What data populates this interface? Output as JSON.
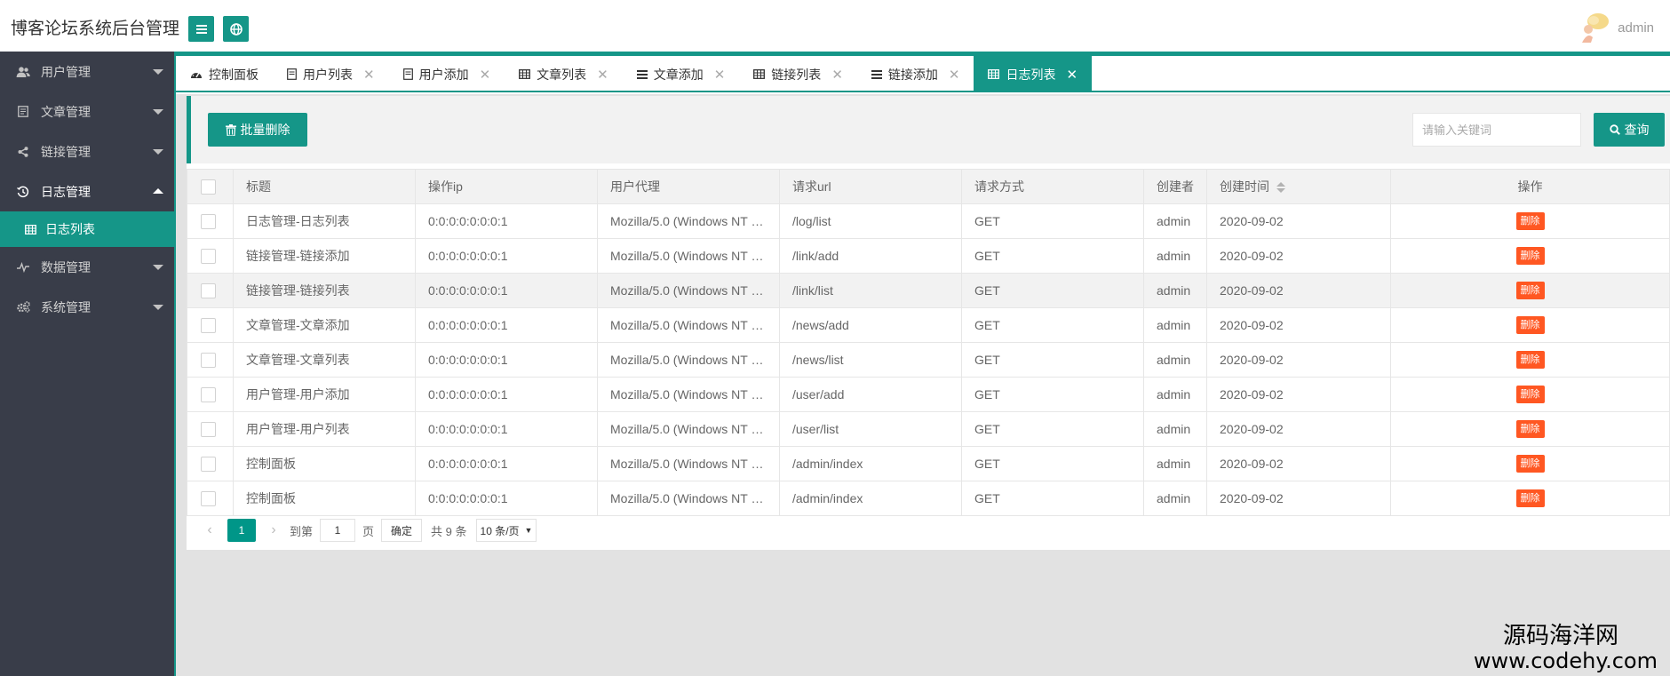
{
  "app": {
    "title": "博客论坛系统后台管理"
  },
  "header": {
    "username": "admin"
  },
  "sidebar": {
    "items": [
      {
        "label": "用户管理",
        "icon": "users-icon"
      },
      {
        "label": "文章管理",
        "icon": "article-icon"
      },
      {
        "label": "链接管理",
        "icon": "share-icon"
      },
      {
        "label": "日志管理",
        "icon": "log-icon"
      },
      {
        "label": "数据管理",
        "icon": "chart-icon"
      },
      {
        "label": "系统管理",
        "icon": "gears-icon"
      }
    ],
    "subitem": {
      "label": "日志列表"
    }
  },
  "tabs": [
    {
      "label": "控制面板"
    },
    {
      "label": "用户列表"
    },
    {
      "label": "用户添加"
    },
    {
      "label": "文章列表"
    },
    {
      "label": "文章添加"
    },
    {
      "label": "链接列表"
    },
    {
      "label": "链接添加"
    },
    {
      "label": "日志列表"
    }
  ],
  "toolbar": {
    "batch_delete": "批量删除",
    "search_placeholder": "请输入关键词",
    "query": "查询"
  },
  "table": {
    "headers": [
      "标题",
      "操作ip",
      "用户代理",
      "请求url",
      "请求方式",
      "创建者",
      "创建时间",
      "操作"
    ],
    "delete_label": "删除",
    "rows": [
      {
        "title": "日志管理-日志列表",
        "ip": "0:0:0:0:0:0:0:1",
        "agent": "Mozilla/5.0 (Windows NT …",
        "url": "/log/list",
        "method": "GET",
        "creator": "admin",
        "time": "2020-09-02"
      },
      {
        "title": "链接管理-链接添加",
        "ip": "0:0:0:0:0:0:0:1",
        "agent": "Mozilla/5.0 (Windows NT …",
        "url": "/link/add",
        "method": "GET",
        "creator": "admin",
        "time": "2020-09-02"
      },
      {
        "title": "链接管理-链接列表",
        "ip": "0:0:0:0:0:0:0:1",
        "agent": "Mozilla/5.0 (Windows NT …",
        "url": "/link/list",
        "method": "GET",
        "creator": "admin",
        "time": "2020-09-02"
      },
      {
        "title": "文章管理-文章添加",
        "ip": "0:0:0:0:0:0:0:1",
        "agent": "Mozilla/5.0 (Windows NT …",
        "url": "/news/add",
        "method": "GET",
        "creator": "admin",
        "time": "2020-09-02"
      },
      {
        "title": "文章管理-文章列表",
        "ip": "0:0:0:0:0:0:0:1",
        "agent": "Mozilla/5.0 (Windows NT …",
        "url": "/news/list",
        "method": "GET",
        "creator": "admin",
        "time": "2020-09-02"
      },
      {
        "title": "用户管理-用户添加",
        "ip": "0:0:0:0:0:0:0:1",
        "agent": "Mozilla/5.0 (Windows NT …",
        "url": "/user/add",
        "method": "GET",
        "creator": "admin",
        "time": "2020-09-02"
      },
      {
        "title": "用户管理-用户列表",
        "ip": "0:0:0:0:0:0:0:1",
        "agent": "Mozilla/5.0 (Windows NT …",
        "url": "/user/list",
        "method": "GET",
        "creator": "admin",
        "time": "2020-09-02"
      },
      {
        "title": "控制面板",
        "ip": "0:0:0:0:0:0:0:1",
        "agent": "Mozilla/5.0 (Windows NT …",
        "url": "/admin/index",
        "method": "GET",
        "creator": "admin",
        "time": "2020-09-02"
      },
      {
        "title": "控制面板",
        "ip": "0:0:0:0:0:0:0:1",
        "agent": "Mozilla/5.0 (Windows NT …",
        "url": "/admin/index",
        "method": "GET",
        "creator": "admin",
        "time": "2020-09-02"
      }
    ]
  },
  "pager": {
    "current": "1",
    "goto_label": "到第",
    "goto_value": "1",
    "page_unit": "页",
    "confirm": "确定",
    "total": "共 9 条",
    "per_page": "10 条/页"
  },
  "watermark": {
    "line1": "源码海洋网",
    "line2": "www.codehy.com"
  },
  "colors": {
    "accent": "#159688",
    "sidebar_bg": "#393d49",
    "danger": "#ff5722"
  }
}
